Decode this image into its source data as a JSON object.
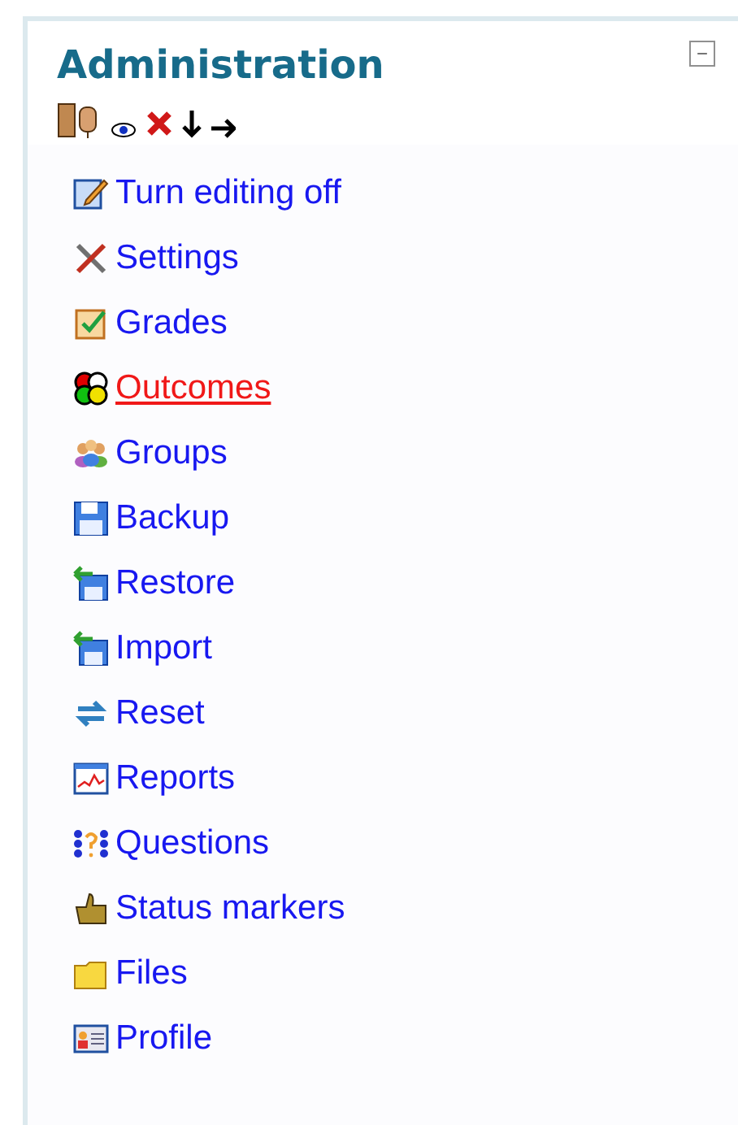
{
  "block": {
    "title": "Administration",
    "collapse_symbol": "−"
  },
  "toolbar": [
    {
      "kind": "roles"
    },
    {
      "kind": "eye"
    },
    {
      "kind": "delete"
    },
    {
      "kind": "down"
    },
    {
      "kind": "right"
    }
  ],
  "items": [
    {
      "label": "Turn editing off",
      "kind": "edit",
      "hovered": false
    },
    {
      "label": "Settings",
      "kind": "tools",
      "hovered": false
    },
    {
      "label": "Grades",
      "kind": "grades",
      "hovered": false
    },
    {
      "label": "Outcomes",
      "kind": "outcomes",
      "hovered": true
    },
    {
      "label": "Groups",
      "kind": "groups",
      "hovered": false
    },
    {
      "label": "Backup",
      "kind": "backup",
      "hovered": false
    },
    {
      "label": "Restore",
      "kind": "restore",
      "hovered": false
    },
    {
      "label": "Import",
      "kind": "restore",
      "hovered": false
    },
    {
      "label": "Reset",
      "kind": "reset",
      "hovered": false
    },
    {
      "label": "Reports",
      "kind": "reports",
      "hovered": false
    },
    {
      "label": "Questions",
      "kind": "questions",
      "hovered": false
    },
    {
      "label": "Status markers",
      "kind": "thumb",
      "hovered": false
    },
    {
      "label": "Files",
      "kind": "folder",
      "hovered": false
    },
    {
      "label": "Profile",
      "kind": "profile",
      "hovered": false
    }
  ]
}
